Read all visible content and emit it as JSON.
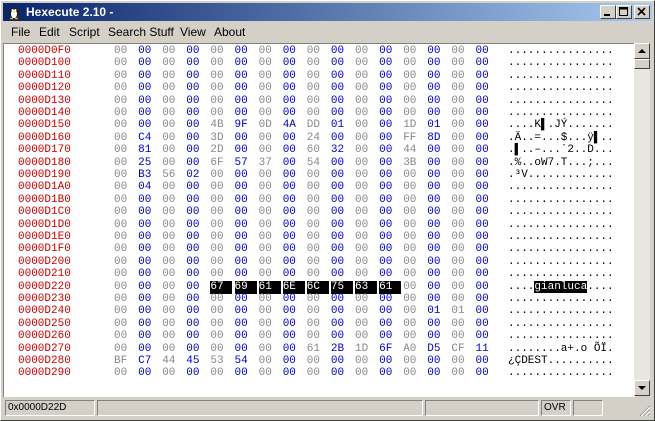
{
  "window": {
    "title": "Hexecute 2.10 -",
    "icon": "app-icon",
    "controls": [
      "minimize-icon",
      "maximize-icon",
      "close-icon"
    ]
  },
  "menu": [
    "File",
    "Edit",
    "Script",
    "Search Stuff",
    "View",
    "About"
  ],
  "hex_rows": [
    {
      "addr": "0000D0F0",
      "bytes": [
        "00",
        "00",
        "00",
        "00",
        "00",
        "00",
        "00",
        "00",
        "00",
        "00",
        "00",
        "00",
        "00",
        "00",
        "00",
        "00"
      ],
      "ascii": "................"
    },
    {
      "addr": "0000D100",
      "bytes": [
        "00",
        "00",
        "00",
        "00",
        "00",
        "00",
        "00",
        "00",
        "00",
        "00",
        "00",
        "00",
        "00",
        "00",
        "00",
        "00"
      ],
      "ascii": "................"
    },
    {
      "addr": "0000D110",
      "bytes": [
        "00",
        "00",
        "00",
        "00",
        "00",
        "00",
        "00",
        "00",
        "00",
        "00",
        "00",
        "00",
        "00",
        "00",
        "00",
        "00"
      ],
      "ascii": "................"
    },
    {
      "addr": "0000D120",
      "bytes": [
        "00",
        "00",
        "00",
        "00",
        "00",
        "00",
        "00",
        "00",
        "00",
        "00",
        "00",
        "00",
        "00",
        "00",
        "00",
        "00"
      ],
      "ascii": "................"
    },
    {
      "addr": "0000D130",
      "bytes": [
        "00",
        "00",
        "00",
        "00",
        "00",
        "00",
        "00",
        "00",
        "00",
        "00",
        "00",
        "00",
        "00",
        "00",
        "00",
        "00"
      ],
      "ascii": "................"
    },
    {
      "addr": "0000D140",
      "bytes": [
        "00",
        "00",
        "00",
        "00",
        "00",
        "00",
        "00",
        "00",
        "00",
        "00",
        "00",
        "00",
        "00",
        "00",
        "00",
        "00"
      ],
      "ascii": "................"
    },
    {
      "addr": "0000D150",
      "bytes": [
        "00",
        "00",
        "00",
        "00",
        "4B",
        "9F",
        "0D",
        "4A",
        "DD",
        "01",
        "00",
        "00",
        "1D",
        "01",
        "00",
        "00"
      ],
      "ascii": "....K▌.JÝ......."
    },
    {
      "addr": "0000D160",
      "bytes": [
        "00",
        "C4",
        "00",
        "00",
        "3D",
        "00",
        "00",
        "00",
        "24",
        "00",
        "00",
        "00",
        "FF",
        "8D",
        "00",
        "00"
      ],
      "ascii": ".Ä..=...$...ÿ▌.."
    },
    {
      "addr": "0000D170",
      "bytes": [
        "00",
        "81",
        "00",
        "00",
        "2D",
        "00",
        "00",
        "00",
        "60",
        "32",
        "00",
        "00",
        "44",
        "00",
        "00",
        "00"
      ],
      "ascii": ".▌..–...`2..D..."
    },
    {
      "addr": "0000D180",
      "bytes": [
        "00",
        "25",
        "00",
        "00",
        "6F",
        "57",
        "37",
        "00",
        "54",
        "00",
        "00",
        "00",
        "3B",
        "00",
        "00",
        "00"
      ],
      "ascii": ".%..oW7.T...;..."
    },
    {
      "addr": "0000D190",
      "bytes": [
        "00",
        "B3",
        "56",
        "02",
        "00",
        "00",
        "00",
        "00",
        "00",
        "00",
        "00",
        "00",
        "00",
        "00",
        "00",
        "00"
      ],
      "ascii": ".³V............."
    },
    {
      "addr": "0000D1A0",
      "bytes": [
        "00",
        "04",
        "00",
        "00",
        "00",
        "00",
        "00",
        "00",
        "00",
        "00",
        "00",
        "00",
        "00",
        "00",
        "00",
        "00"
      ],
      "ascii": "................"
    },
    {
      "addr": "0000D1B0",
      "bytes": [
        "00",
        "00",
        "00",
        "00",
        "00",
        "00",
        "00",
        "00",
        "00",
        "00",
        "00",
        "00",
        "00",
        "00",
        "00",
        "00"
      ],
      "ascii": "................"
    },
    {
      "addr": "0000D1C0",
      "bytes": [
        "00",
        "00",
        "00",
        "00",
        "00",
        "00",
        "00",
        "00",
        "00",
        "00",
        "00",
        "00",
        "00",
        "00",
        "00",
        "00"
      ],
      "ascii": "................"
    },
    {
      "addr": "0000D1D0",
      "bytes": [
        "00",
        "00",
        "00",
        "00",
        "00",
        "00",
        "00",
        "00",
        "00",
        "00",
        "00",
        "00",
        "00",
        "00",
        "00",
        "00"
      ],
      "ascii": "................"
    },
    {
      "addr": "0000D1E0",
      "bytes": [
        "00",
        "00",
        "00",
        "00",
        "00",
        "00",
        "00",
        "00",
        "00",
        "00",
        "00",
        "00",
        "00",
        "00",
        "00",
        "00"
      ],
      "ascii": "................"
    },
    {
      "addr": "0000D1F0",
      "bytes": [
        "00",
        "00",
        "00",
        "00",
        "00",
        "00",
        "00",
        "00",
        "00",
        "00",
        "00",
        "00",
        "00",
        "00",
        "00",
        "00"
      ],
      "ascii": "................"
    },
    {
      "addr": "0000D200",
      "bytes": [
        "00",
        "00",
        "00",
        "00",
        "00",
        "00",
        "00",
        "00",
        "00",
        "00",
        "00",
        "00",
        "00",
        "00",
        "00",
        "00"
      ],
      "ascii": "................"
    },
    {
      "addr": "0000D210",
      "bytes": [
        "00",
        "00",
        "00",
        "00",
        "00",
        "00",
        "00",
        "00",
        "00",
        "00",
        "00",
        "00",
        "00",
        "00",
        "00",
        "00"
      ],
      "ascii": "................"
    },
    {
      "addr": "0000D220",
      "bytes": [
        "00",
        "00",
        "00",
        "00",
        "67",
        "69",
        "61",
        "6E",
        "6C",
        "75",
        "63",
        "61",
        "00",
        "00",
        "00",
        "00"
      ],
      "ascii": "....gianluca....",
      "selection": [
        4,
        11
      ]
    },
    {
      "addr": "0000D230",
      "bytes": [
        "00",
        "00",
        "00",
        "00",
        "00",
        "00",
        "00",
        "00",
        "00",
        "00",
        "00",
        "00",
        "00",
        "00",
        "00",
        "00"
      ],
      "ascii": "................"
    },
    {
      "addr": "0000D240",
      "bytes": [
        "00",
        "00",
        "00",
        "00",
        "00",
        "00",
        "00",
        "00",
        "00",
        "00",
        "00",
        "00",
        "00",
        "01",
        "01",
        "00"
      ],
      "ascii": "................"
    },
    {
      "addr": "0000D250",
      "bytes": [
        "00",
        "00",
        "00",
        "00",
        "00",
        "00",
        "00",
        "00",
        "00",
        "00",
        "00",
        "00",
        "00",
        "00",
        "00",
        "00"
      ],
      "ascii": "................"
    },
    {
      "addr": "0000D260",
      "bytes": [
        "00",
        "00",
        "00",
        "00",
        "00",
        "00",
        "00",
        "00",
        "00",
        "00",
        "00",
        "00",
        "00",
        "00",
        "00",
        "00"
      ],
      "ascii": "................"
    },
    {
      "addr": "0000D270",
      "bytes": [
        "00",
        "00",
        "00",
        "00",
        "00",
        "00",
        "00",
        "00",
        "61",
        "2B",
        "1D",
        "6F",
        "A0",
        "D5",
        "CF",
        "11"
      ],
      "ascii": "........a+.o ÕÏ."
    },
    {
      "addr": "0000D280",
      "bytes": [
        "BF",
        "C7",
        "44",
        "45",
        "53",
        "54",
        "00",
        "00",
        "00",
        "00",
        "00",
        "00",
        "00",
        "00",
        "00",
        "00"
      ],
      "ascii": "¿ÇDEST.........."
    },
    {
      "addr": "0000D290",
      "bytes": [
        "00",
        "00",
        "00",
        "00",
        "00",
        "00",
        "00",
        "00",
        "00",
        "00",
        "00",
        "00",
        "00",
        "00",
        "00",
        "00"
      ],
      "ascii": "................"
    }
  ],
  "status": {
    "offset": "0x0000D22D",
    "panel2": "",
    "panel3": "",
    "mode": "OVR",
    "panel5": ""
  },
  "colors": {
    "address": "#cc0000",
    "hex_even": "#0000cc",
    "hex_odd": "#888888",
    "selection_bg": "#000000",
    "titlebar_start": "#0a246a",
    "titlebar_end": "#a6caf0"
  }
}
